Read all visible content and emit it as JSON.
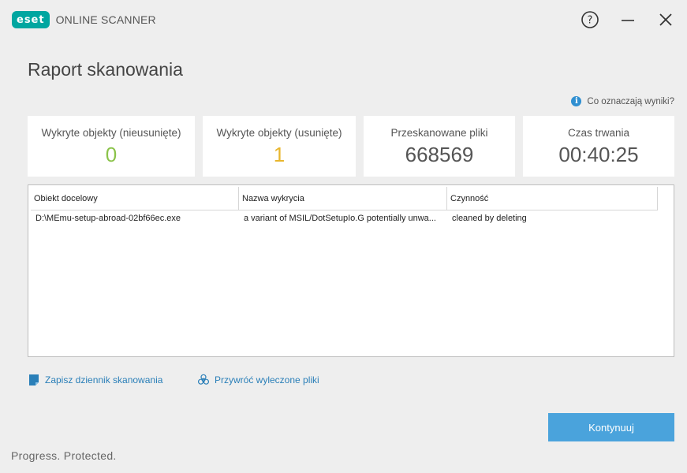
{
  "app": {
    "logo_text": "eset",
    "product_name": "ONLINE SCANNER"
  },
  "window_controls": {
    "help": "?"
  },
  "page": {
    "title": "Raport skanowania",
    "help_link": "Co oznaczają wyniki?"
  },
  "stats": [
    {
      "label": "Wykryte objekty (nieusunięte)",
      "value": "0",
      "color": "#8bc34a"
    },
    {
      "label": "Wykryte objekty (usunięte)",
      "value": "1",
      "color": "#e8b62d"
    },
    {
      "label": "Przeskanowane pliki",
      "value": "668569"
    },
    {
      "label": "Czas trwania",
      "value": "00:40:25"
    }
  ],
  "table": {
    "columns": [
      "Obiekt docelowy",
      "Nazwa wykrycia",
      "Czynność"
    ],
    "rows": [
      [
        "D:\\MEmu-setup-abroad-02bf66ec.exe",
        "a variant of MSIL/DotSetupIo.G potentially unwa...",
        "cleaned by deleting"
      ]
    ]
  },
  "actions": {
    "save_log": "Zapisz dziennik skanowania",
    "restore_files": "Przywróć wyleczone pliki",
    "continue": "Kontynuuj"
  },
  "footer": {
    "slogan": "Progress. Protected."
  },
  "colors": {
    "accent": "#4aa3dc",
    "link": "#2a7fb8",
    "brand": "#00a6a0"
  }
}
